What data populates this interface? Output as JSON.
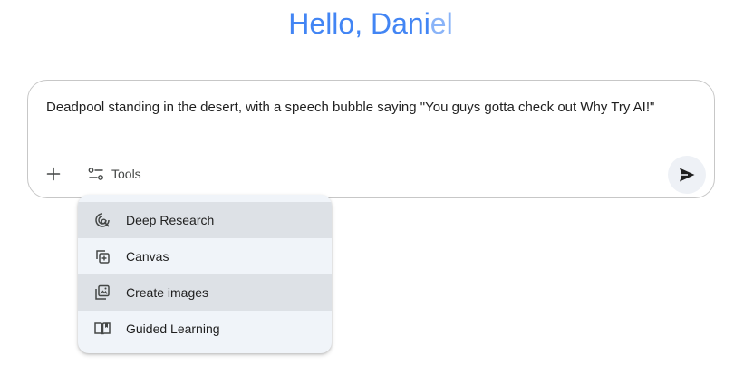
{
  "greeting": {
    "main": "Hello, Dani",
    "faded": "el"
  },
  "prompt": {
    "text": "Deadpool standing in the desert, with a speech bubble saying \"You guys gotta check out Why Try AI!\""
  },
  "toolbar": {
    "tools_label": "Tools"
  },
  "tools_menu": {
    "items": [
      {
        "label": "Deep Research",
        "icon": "deep-research-icon",
        "highlighted": true
      },
      {
        "label": "Canvas",
        "icon": "canvas-icon",
        "highlighted": false
      },
      {
        "label": "Create images",
        "icon": "create-images-icon",
        "highlighted": true
      },
      {
        "label": "Guided Learning",
        "icon": "guided-learning-icon",
        "highlighted": false
      }
    ]
  },
  "colors": {
    "greeting": "#4285f4",
    "greeting_faded": "#8ab4f8",
    "menu_bg": "#f0f4f9",
    "menu_highlight": "#dde1e6"
  }
}
